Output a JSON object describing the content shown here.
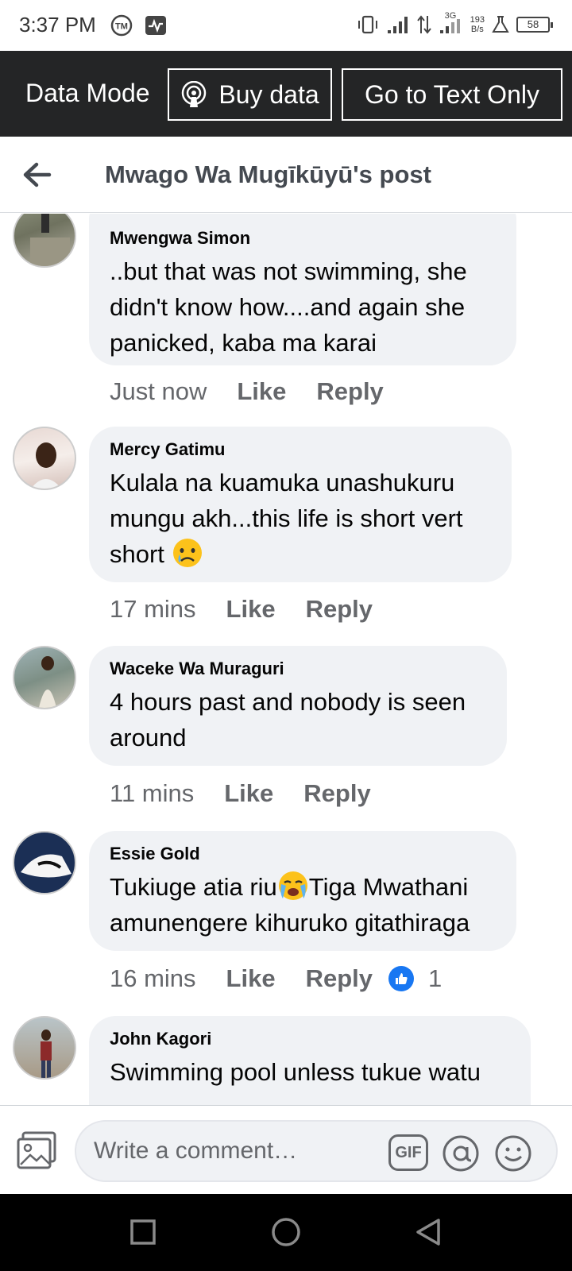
{
  "status_bar": {
    "time": "3:37 PM",
    "network": "3G",
    "speed_value": "193",
    "speed_unit": "B/s",
    "battery": "58"
  },
  "data_bar": {
    "label": "Data Mode",
    "buy_data": "Buy data",
    "text_only": "Go to Text Only"
  },
  "header": {
    "title": "Mwago Wa Mugīkūyū's post"
  },
  "comments": [
    {
      "author": "Mwengwa Simon",
      "text": "..but that was not swimming, she didn't know how....and again she panicked, kaba ma karai",
      "time": "Just now",
      "like": "Like",
      "reply": "Reply"
    },
    {
      "author": "Mercy Gatimu",
      "text": "Kulala na kuamuka unashukuru mungu akh...this life is short vert short ",
      "time": "17 mins",
      "like": "Like",
      "reply": "Reply",
      "emoji": "sad-tear-emoji"
    },
    {
      "author": "Waceke Wa Muraguri",
      "text": "4 hours past and nobody is seen around",
      "time": "11 mins",
      "like": "Like",
      "reply": "Reply"
    },
    {
      "author": "Essie Gold",
      "text_a": "Tukiuge atia riu",
      "text_b": "Tiga Mwathani amunengere kihuruko gitathiraga",
      "time": "16 mins",
      "like": "Like",
      "reply": "Reply",
      "reaction_count": "1",
      "emoji": "loudly-crying-emoji",
      "reaction_icon": "thumbs-up-icon"
    },
    {
      "author": "John Kagori",
      "text": "Swimming pool unless tukue watu"
    }
  ],
  "composer": {
    "placeholder": "Write a comment…",
    "gif_label": "GIF"
  },
  "colors": {
    "dark_bar": "#242526",
    "bubble": "#f0f2f5",
    "meta": "#65676b",
    "like_blue": "#1877f2"
  }
}
